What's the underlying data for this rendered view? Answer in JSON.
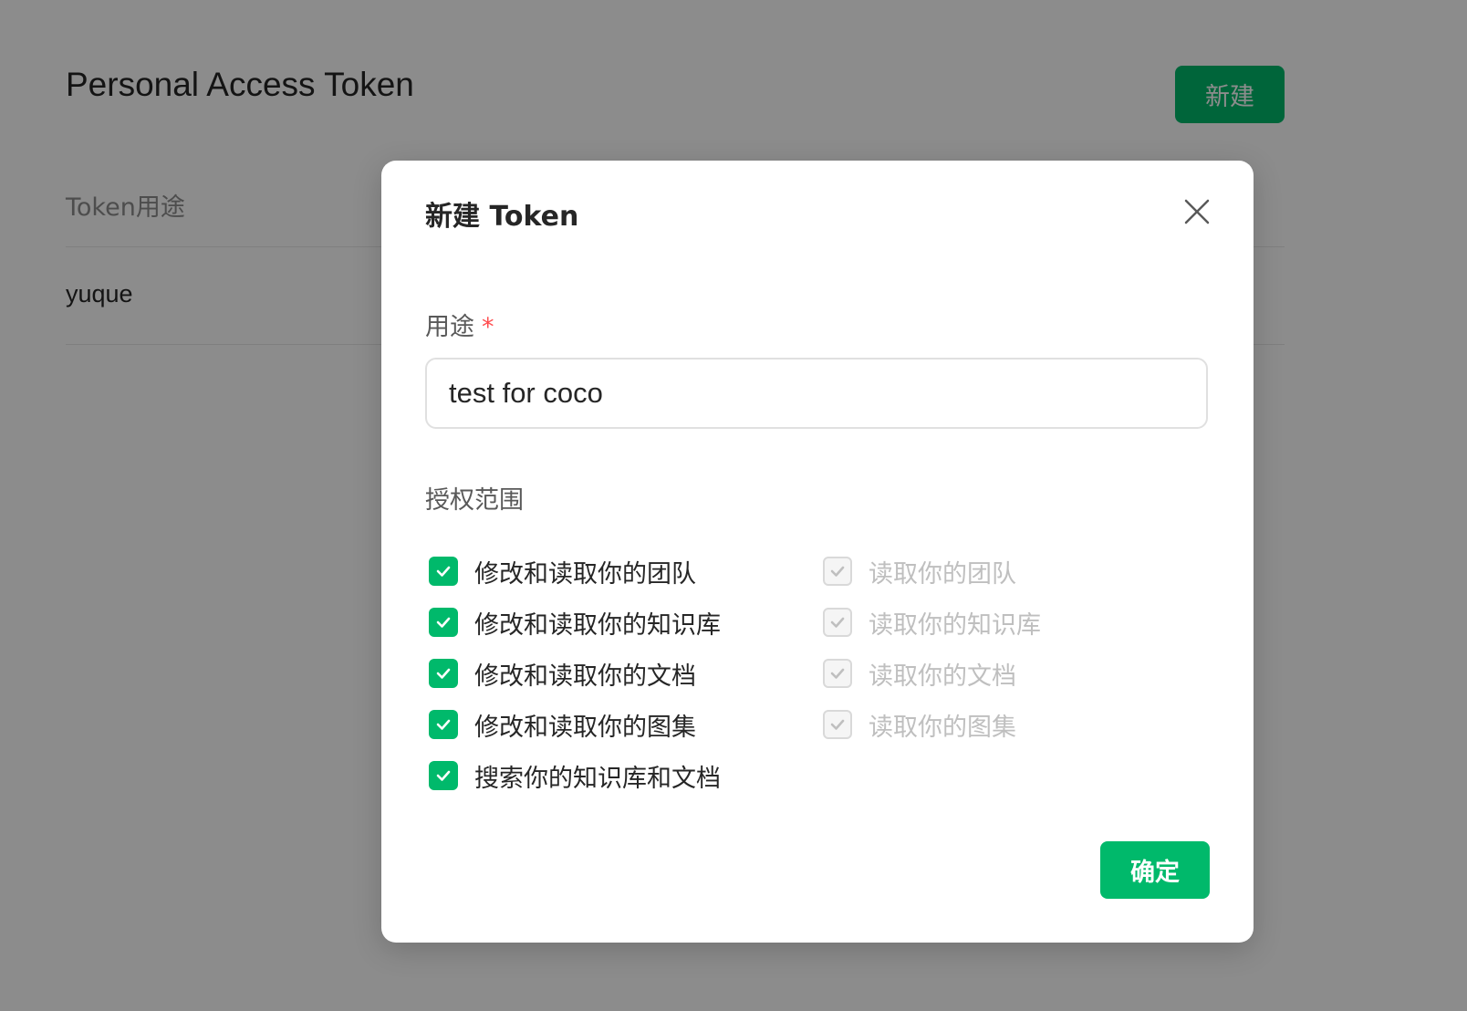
{
  "page": {
    "title": "Personal Access Token",
    "create_button": "新建",
    "table": {
      "header": "Token用途",
      "rows": [
        {
          "purpose": "yuque"
        }
      ]
    }
  },
  "modal": {
    "title": "新建 Token",
    "purpose_label": "用途",
    "required_mark": "*",
    "purpose_value": "test for coco",
    "scope_label": "授权范围",
    "scopes_left": [
      {
        "label": "修改和读取你的团队",
        "checked": true
      },
      {
        "label": "修改和读取你的知识库",
        "checked": true
      },
      {
        "label": "修改和读取你的文档",
        "checked": true
      },
      {
        "label": "修改和读取你的图集",
        "checked": true
      },
      {
        "label": "搜索你的知识库和文档",
        "checked": true
      }
    ],
    "scopes_right": [
      {
        "label": "读取你的团队",
        "checked": true,
        "disabled": true
      },
      {
        "label": "读取你的知识库",
        "checked": true,
        "disabled": true
      },
      {
        "label": "读取你的文档",
        "checked": true,
        "disabled": true
      },
      {
        "label": "读取你的图集",
        "checked": true,
        "disabled": true
      }
    ],
    "confirm_button": "确定"
  },
  "colors": {
    "brand_green": "#00b96b",
    "required_red": "#ff4d4f",
    "disabled_text": "#bfbfbf"
  },
  "icons": {
    "close": "close-icon",
    "check": "check-icon"
  }
}
